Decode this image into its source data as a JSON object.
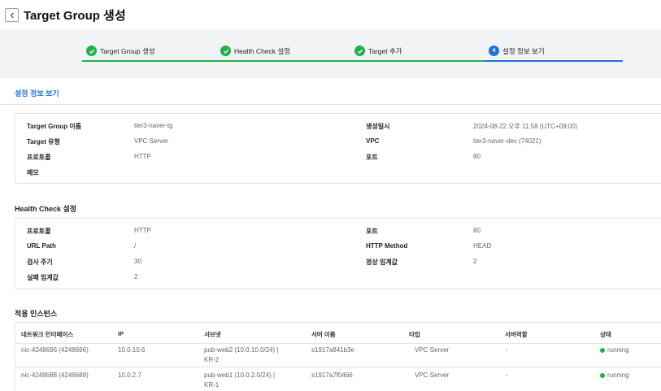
{
  "header": {
    "title": "Target Group 생성"
  },
  "steps": [
    {
      "label": "Target Group 생성",
      "status": "done"
    },
    {
      "label": "Health Check 설정",
      "status": "done"
    },
    {
      "label": "Target 추가",
      "status": "done"
    },
    {
      "label": "설정 정보 보기",
      "status": "active",
      "number": "4"
    }
  ],
  "colors": {
    "done": "#1fb14a",
    "active": "#1f6fe6",
    "band": "#f2f3f5"
  },
  "section": {
    "title": "설정 정보 보기"
  },
  "target_group": {
    "left": [
      {
        "label": "Target Group 이름",
        "value": "tier3-naver-tg"
      },
      {
        "label": "Target 유형",
        "value": "VPC Server"
      },
      {
        "label": "프로토콜",
        "value": "HTTP"
      },
      {
        "label": "메모",
        "value": ""
      }
    ],
    "right": [
      {
        "label": "생성일시",
        "value": "2024-08-22 오후 11:58 (UTC+09:00)"
      },
      {
        "label": "VPC",
        "value": "tier3-naver-dev (74021)"
      },
      {
        "label": "포트",
        "value": "80"
      }
    ]
  },
  "health_check": {
    "title": "Health Check 설정",
    "left": [
      {
        "label": "프로토콜",
        "value": "HTTP"
      },
      {
        "label": "URL Path",
        "value": "/"
      },
      {
        "label": "검사 주기",
        "value": "30"
      },
      {
        "label": "실패 임계값",
        "value": "2"
      }
    ],
    "right": [
      {
        "label": "포트",
        "value": "80"
      },
      {
        "label": "HTTP Method",
        "value": "HEAD"
      },
      {
        "label": "정상 임계값",
        "value": "2"
      }
    ]
  },
  "instances": {
    "title": "적용 인스턴스",
    "columns": [
      "네트워크 인터페이스",
      "IP",
      "서브넷",
      "서버 이름",
      "타입",
      "서버역할",
      "상태"
    ],
    "rows": [
      {
        "nic": "nic-4248696 (4248696)",
        "ip": "10.0.10.6",
        "subnet_1": "pub-web2 (10.0.10.0/24) |",
        "subnet_2": "KR-2",
        "server": "s1917a841b3e",
        "type": "VPC Server",
        "role": "-",
        "status": "running"
      },
      {
        "nic": "nic-4248688 (4248688)",
        "ip": "10.0.2.7",
        "subnet_1": "pub-web1 (10.0.2.0/24) |",
        "subnet_2": "KR-1",
        "server": "s1917a7f0466",
        "type": "VPC Server",
        "role": "-",
        "status": "running"
      }
    ]
  }
}
